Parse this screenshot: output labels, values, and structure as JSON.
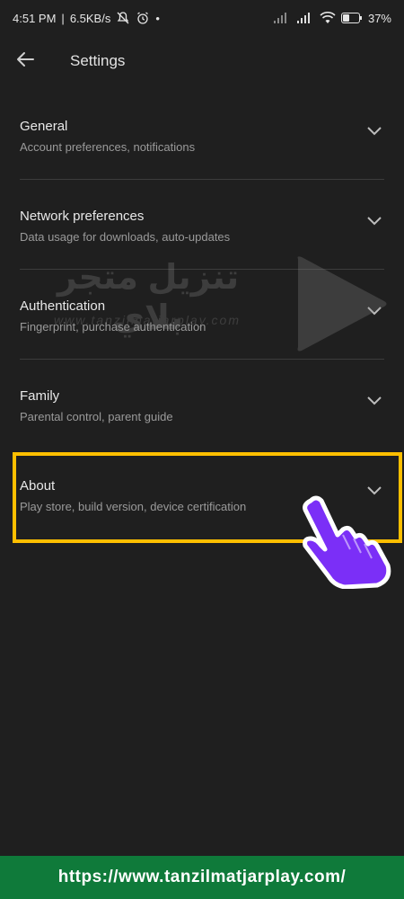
{
  "status_bar": {
    "time": "4:51 PM",
    "speed": "6.5KB/s",
    "battery": "37%"
  },
  "app_bar": {
    "title": "Settings"
  },
  "settings": [
    {
      "title": "General",
      "subtitle": "Account preferences, notifications"
    },
    {
      "title": "Network preferences",
      "subtitle": "Data usage for downloads, auto-updates"
    },
    {
      "title": "Authentication",
      "subtitle": "Fingerprint, purchase authentication"
    },
    {
      "title": "Family",
      "subtitle": "Parental control, parent guide"
    },
    {
      "title": "About",
      "subtitle": "Play store, build version, device certification"
    }
  ],
  "watermark": {
    "text": "تنزيل متجر بلاي",
    "url": "www.tanzilmatjarplay.com"
  },
  "footer": {
    "url": "https://www.tanzilmatjarplay.com/"
  },
  "colors": {
    "background": "#1f1f1f",
    "highlight": "#ffbf00",
    "footer": "#0f7a3a",
    "hand": "#7b2ff7"
  }
}
